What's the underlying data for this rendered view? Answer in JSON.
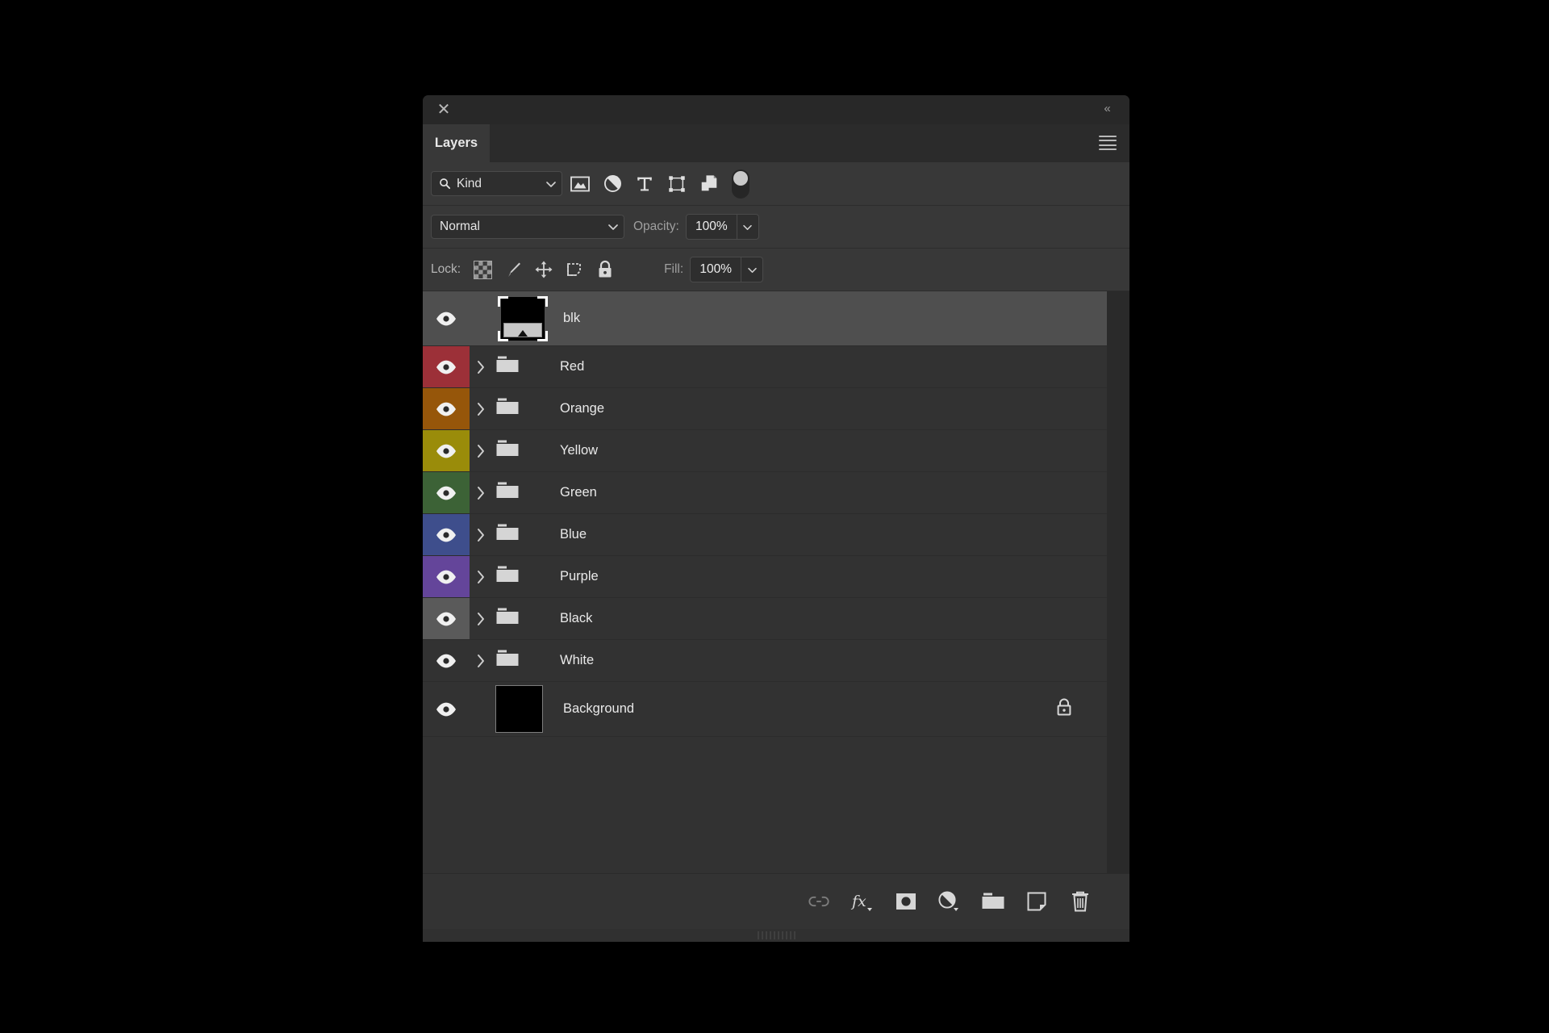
{
  "panel": {
    "title": "Layers",
    "close_icon": "close-icon",
    "collapse_icon": "double-chevron-left-icon",
    "menu_icon": "hamburger-menu-icon"
  },
  "filter": {
    "kind_label": "Kind",
    "search_icon": "search-icon",
    "chevron_icon": "chevron-down-icon",
    "icons": [
      {
        "name": "filter-pixel-layers-icon",
        "title": "Pixel layers"
      },
      {
        "name": "filter-adjustment-layers-icon",
        "title": "Adjustment layers"
      },
      {
        "name": "filter-type-layers-icon",
        "title": "Type layers"
      },
      {
        "name": "filter-shape-layers-icon",
        "title": "Shape layers"
      },
      {
        "name": "filter-smart-object-layers-icon",
        "title": "Smart objects"
      }
    ],
    "toggle_name": "filter-enable-toggle"
  },
  "options": {
    "blend_mode": "Normal",
    "opacity_label": "Opacity:",
    "opacity_value": "100%",
    "fill_label": "Fill:",
    "fill_value": "100%",
    "lock_label": "Lock:",
    "lock_icons": [
      {
        "name": "lock-transparent-pixels-icon"
      },
      {
        "name": "lock-image-pixels-icon"
      },
      {
        "name": "lock-position-icon"
      },
      {
        "name": "lock-artboard-nesting-icon"
      },
      {
        "name": "lock-all-icon"
      }
    ]
  },
  "layers": [
    {
      "name": "blk",
      "type": "adjustment",
      "selected": true,
      "swatch": "none",
      "visible": true,
      "expandable": false,
      "locked": false
    },
    {
      "name": "Red",
      "type": "group",
      "selected": false,
      "swatch": "#9c3038",
      "visible": true,
      "expandable": true,
      "locked": false
    },
    {
      "name": "Orange",
      "type": "group",
      "selected": false,
      "swatch": "#96560a",
      "visible": true,
      "expandable": true,
      "locked": false
    },
    {
      "name": "Yellow",
      "type": "group",
      "selected": false,
      "swatch": "#9a8c0a",
      "visible": true,
      "expandable": true,
      "locked": false
    },
    {
      "name": "Green",
      "type": "group",
      "selected": false,
      "swatch": "#3c6236",
      "visible": true,
      "expandable": true,
      "locked": false
    },
    {
      "name": "Blue",
      "type": "group",
      "selected": false,
      "swatch": "#3e4e8c",
      "visible": true,
      "expandable": true,
      "locked": false
    },
    {
      "name": "Purple",
      "type": "group",
      "selected": false,
      "swatch": "#64459a",
      "visible": true,
      "expandable": true,
      "locked": false
    },
    {
      "name": "Black",
      "type": "group",
      "selected": false,
      "swatch": "#5a5a5a",
      "visible": true,
      "expandable": true,
      "locked": false
    },
    {
      "name": "White",
      "type": "group",
      "selected": false,
      "swatch": "none",
      "visible": true,
      "expandable": true,
      "locked": false
    },
    {
      "name": "Background",
      "type": "pixel",
      "selected": false,
      "swatch": "none",
      "visible": true,
      "expandable": false,
      "locked": true
    }
  ],
  "bottom_toolbar": [
    {
      "name": "link-layers-button",
      "label": "link-icon",
      "disabled": true
    },
    {
      "name": "layer-styles-button",
      "label": "fx-icon",
      "disabled": false
    },
    {
      "name": "add-layer-mask-button",
      "label": "mask-icon",
      "disabled": false
    },
    {
      "name": "new-adjustment-layer-button",
      "label": "adjustment-icon",
      "disabled": false
    },
    {
      "name": "new-group-button",
      "label": "folder-icon",
      "disabled": false
    },
    {
      "name": "new-layer-button",
      "label": "new-layer-icon",
      "disabled": false
    },
    {
      "name": "delete-layer-button",
      "label": "trash-icon",
      "disabled": false
    }
  ]
}
